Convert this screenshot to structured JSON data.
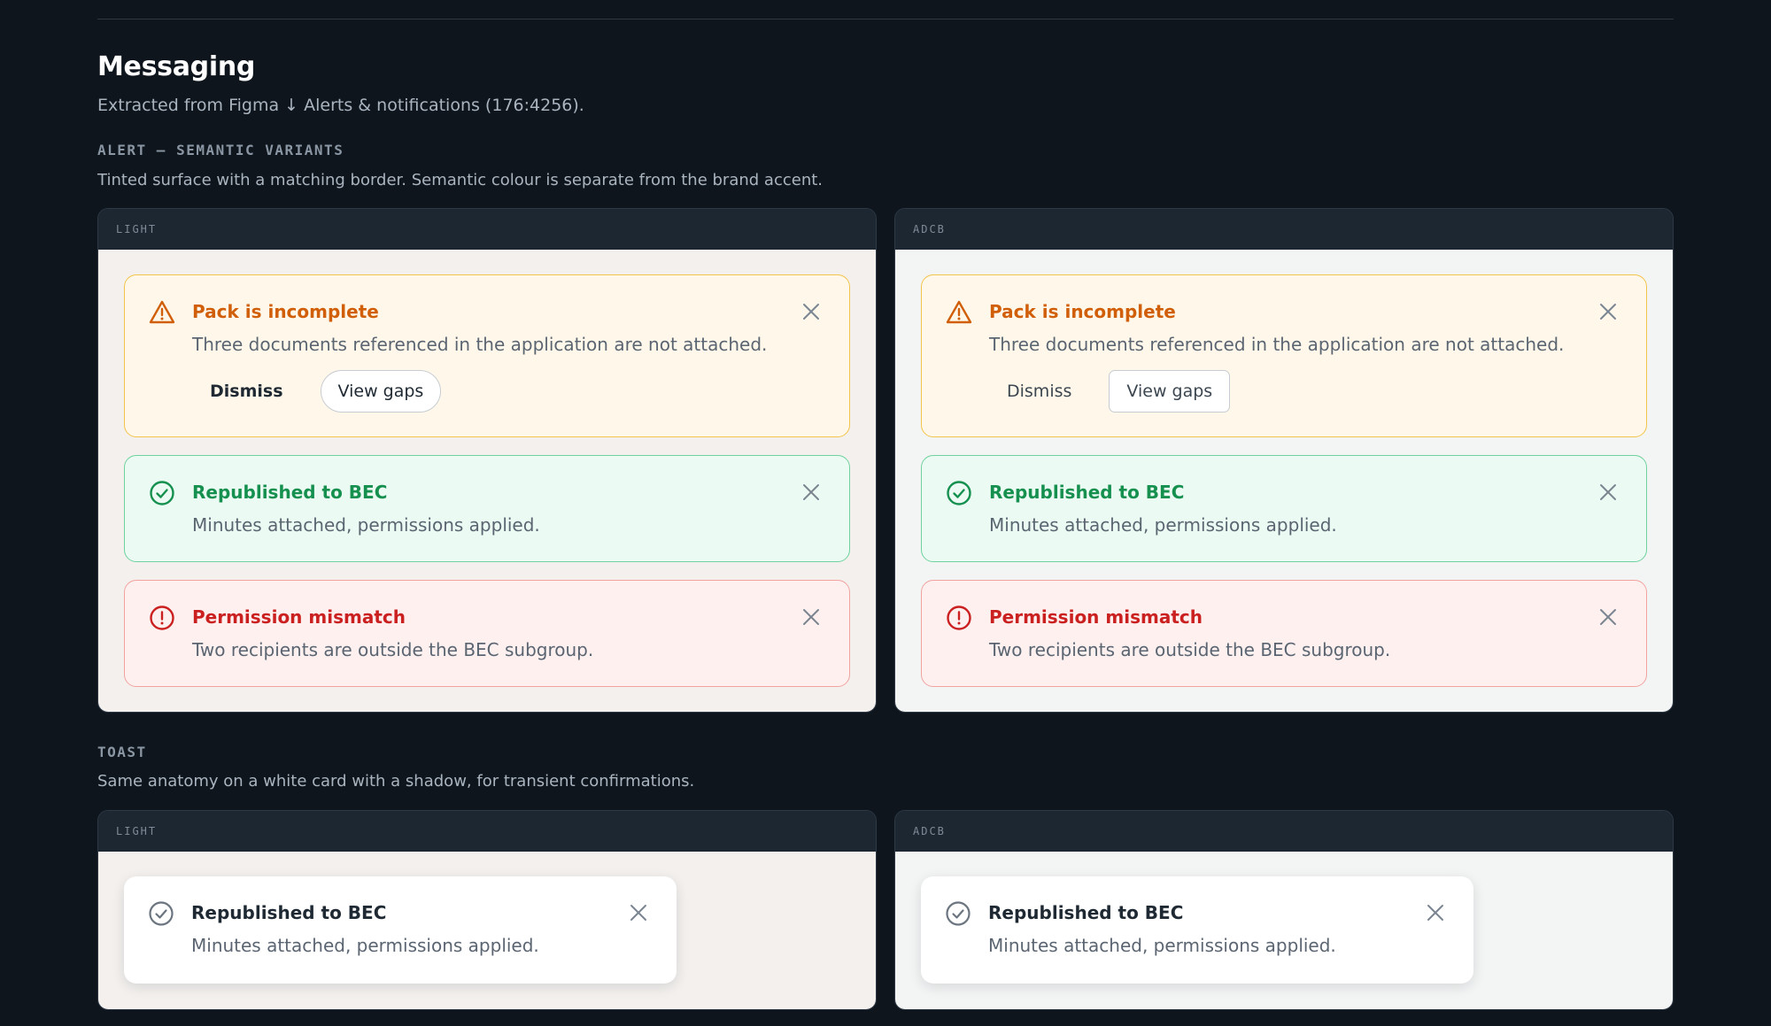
{
  "page": {
    "title": "Messaging",
    "subtitle": "Extracted from Figma ↓ Alerts & notifications (176:4256)."
  },
  "alert_section": {
    "label": "ALERT — SEMANTIC VARIANTS",
    "description": "Tinted surface with a matching border. Semantic colour is separate from the brand accent."
  },
  "toast_section": {
    "label": "TOAST",
    "description": "Same anatomy on a white card with a shadow, for transient confirmations."
  },
  "themes": {
    "light": "LIGHT",
    "adcb": "ADCB"
  },
  "alerts": {
    "warning": {
      "title": "Pack is incomplete",
      "message": "Three documents referenced in the application are not attached.",
      "dismiss_label": "Dismiss",
      "view_gaps_label": "View gaps",
      "icon": "warning-triangle-icon",
      "color": "#d15f0a"
    },
    "success": {
      "title": "Republished to BEC",
      "message": "Minutes attached, permissions applied.",
      "icon": "check-circle-icon",
      "color": "#15904f"
    },
    "danger": {
      "title": "Permission mismatch",
      "message": "Two recipients are outside the BEC subgroup.",
      "icon": "alert-circle-icon",
      "color": "#cb2020"
    }
  },
  "toast": {
    "title": "Republished to BEC",
    "message": "Minutes attached, permissions applied.",
    "icon": "check-circle-icon"
  }
}
